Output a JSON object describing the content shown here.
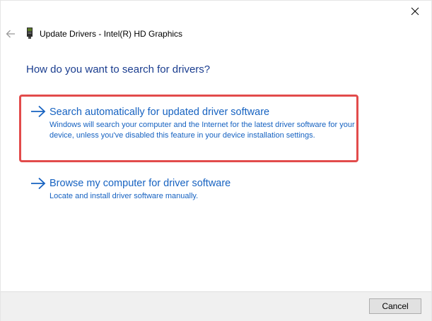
{
  "window": {
    "title": "Update Drivers - Intel(R) HD Graphics",
    "close_icon": "close-icon",
    "back_icon": "back-arrow-icon",
    "device_icon": "display-adapter-icon"
  },
  "main": {
    "question": "How do you want to search for drivers?",
    "options": [
      {
        "title": "Search automatically for updated driver software",
        "description": "Windows will search your computer and the Internet for the latest driver software for your device, unless you've disabled this feature in your device installation settings.",
        "icon": "right-arrow-icon",
        "highlighted": true,
        "highlight_color": "#e24b4b"
      },
      {
        "title": "Browse my computer for driver software",
        "description": "Locate and install driver software manually.",
        "icon": "right-arrow-icon",
        "highlighted": false
      }
    ]
  },
  "footer": {
    "cancel_label": "Cancel"
  },
  "colors": {
    "link_blue": "#1662c1",
    "heading_blue": "#1a3d8f",
    "footer_bg": "#f0f0f0"
  }
}
